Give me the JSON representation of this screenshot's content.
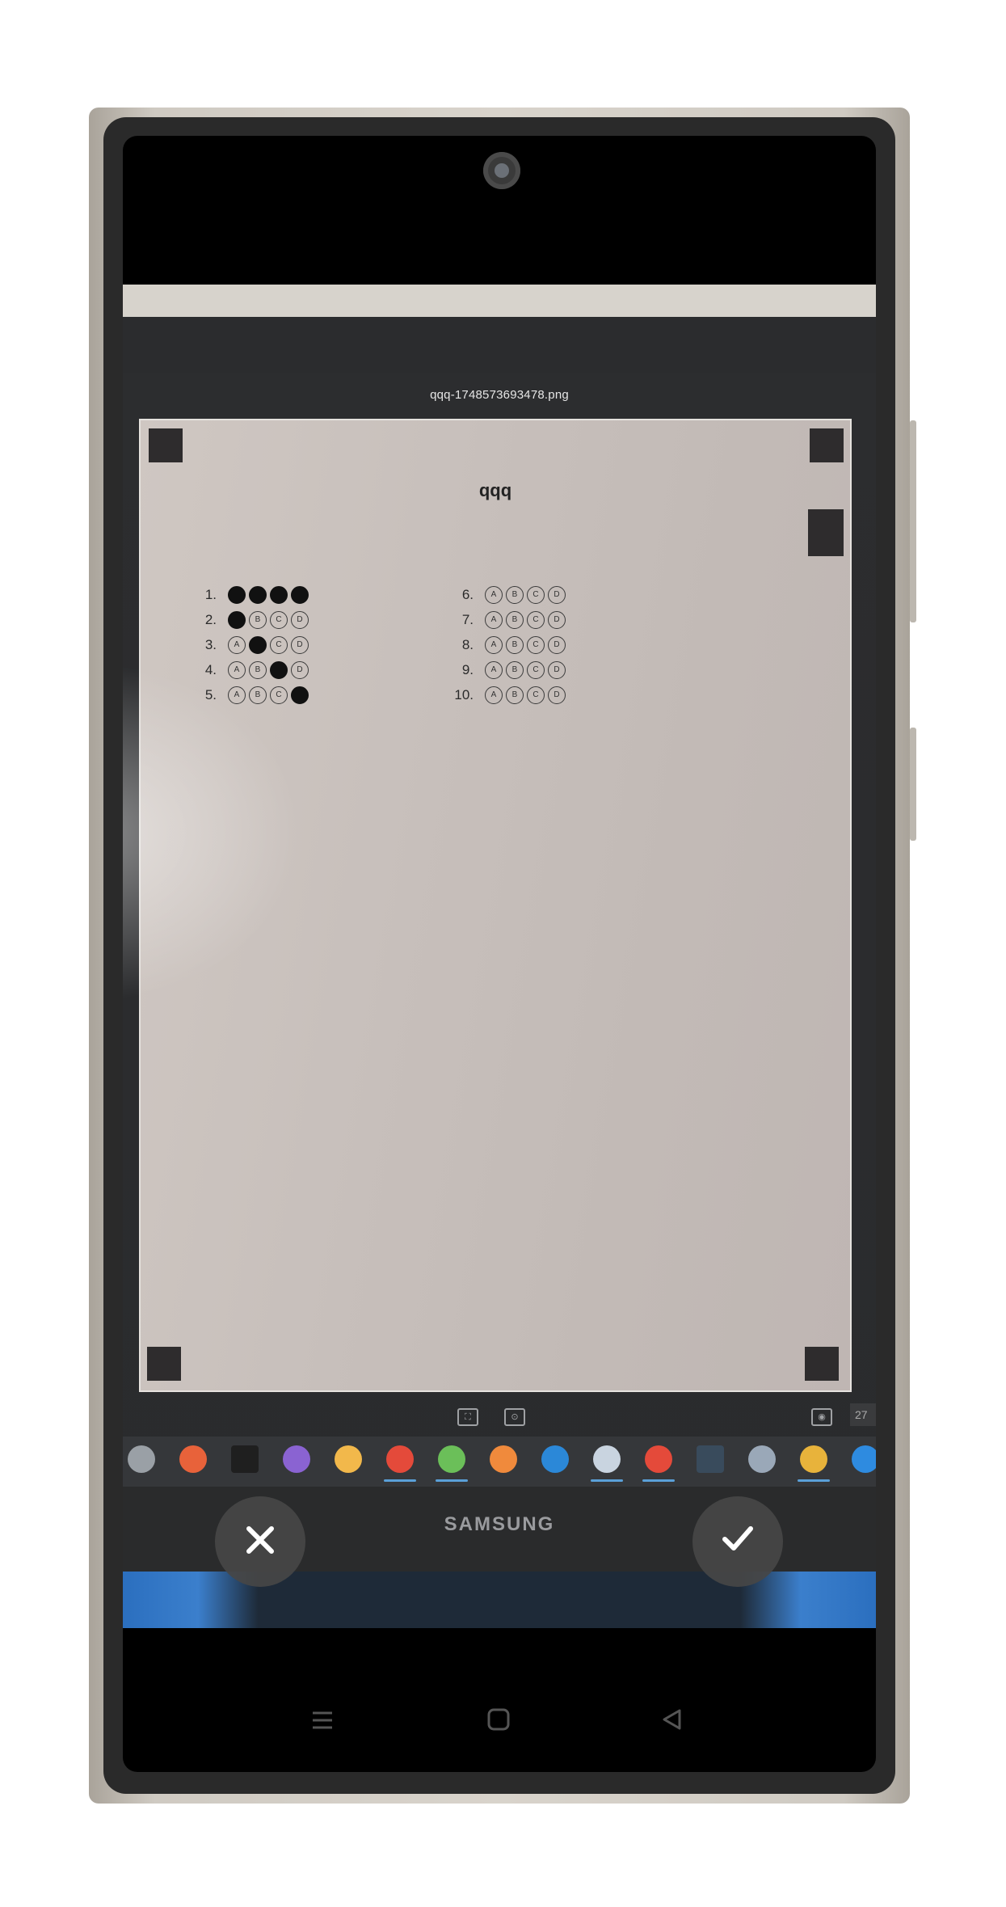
{
  "viewer": {
    "file_title": "qqq-1748573693478.png",
    "page_number": "27"
  },
  "document": {
    "title": "qqq",
    "options": [
      "A",
      "B",
      "C",
      "D"
    ],
    "questions": [
      {
        "number": "1.",
        "filled": [
          true,
          true,
          true,
          true
        ]
      },
      {
        "number": "2.",
        "filled": [
          true,
          false,
          false,
          false
        ]
      },
      {
        "number": "3.",
        "filled": [
          false,
          true,
          false,
          false
        ]
      },
      {
        "number": "4.",
        "filled": [
          false,
          false,
          true,
          false
        ]
      },
      {
        "number": "5.",
        "filled": [
          false,
          false,
          false,
          true
        ]
      },
      {
        "number": "6.",
        "filled": [
          false,
          false,
          false,
          false
        ]
      },
      {
        "number": "7.",
        "filled": [
          false,
          false,
          false,
          false
        ]
      },
      {
        "number": "8.",
        "filled": [
          false,
          false,
          false,
          false
        ]
      },
      {
        "number": "9.",
        "filled": [
          false,
          false,
          false,
          false
        ]
      },
      {
        "number": "10.",
        "filled": [
          false,
          false,
          false,
          false
        ]
      }
    ]
  },
  "monitor": {
    "brand": "SAMSUNG"
  },
  "taskbar": {
    "icons": [
      "settings-icon",
      "brush-app-icon",
      "terminal-icon",
      "github-icon",
      "file-explorer-icon",
      "chrome-profile-icon",
      "clover-app-icon",
      "xampp-icon",
      "edge-icon",
      "chrome-profile-icon",
      "chrome-profile-icon",
      "powershell-icon",
      "notes-app-icon",
      "chrome-icon",
      "vscode-icon"
    ]
  },
  "actions": {
    "cancel_icon": "close-icon",
    "confirm_icon": "check-icon"
  },
  "navigation": {
    "recents_icon": "recents-icon",
    "home_icon": "home-icon",
    "back_icon": "back-icon"
  }
}
